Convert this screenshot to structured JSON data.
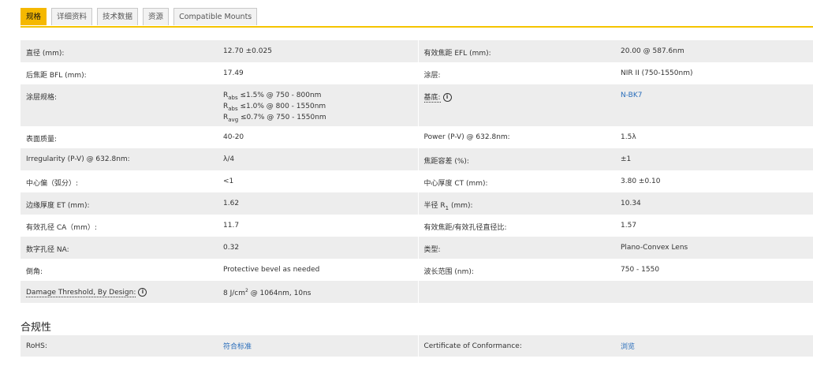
{
  "tabs": [
    {
      "label": "规格",
      "active": true
    },
    {
      "label": "详细资料",
      "active": false
    },
    {
      "label": "技术数据",
      "active": false
    },
    {
      "label": "资源",
      "active": false
    },
    {
      "label": "Compatible Mounts",
      "active": false
    }
  ],
  "specs": {
    "r1": {
      "l1": "直径 (mm):",
      "v1": "12.70 ±0.025",
      "l2": "有效焦距 EFL (mm):",
      "v2": "20.00 @ 587.6nm"
    },
    "r2": {
      "l1": "后焦距 BFL (mm):",
      "v1": "17.49",
      "l2": "涂层:",
      "v2": "NIR II (750-1550nm)"
    },
    "r3": {
      "l1": "涂层规格:",
      "coating": [
        {
          "sym": "R",
          "sub": "abs",
          "text": " ≤1.5% @ 750 - 800nm"
        },
        {
          "sym": "R",
          "sub": "abs",
          "text": " ≤1.0% @ 800 - 1550nm"
        },
        {
          "sym": "R",
          "sub": "avg",
          "text": " ≤0.7% @ 750 - 1550nm"
        }
      ],
      "l2": "基底:",
      "v2": "N-BK7"
    },
    "r4": {
      "l1": "表面质量:",
      "v1": "40-20",
      "l2": "Power (P-V) @ 632.8nm:",
      "v2": "1.5λ"
    },
    "r5": {
      "l1": "Irregularity (P-V) @ 632.8nm:",
      "v1": "λ/4",
      "l2": "焦距容差 (%):",
      "v2": "±1"
    },
    "r6": {
      "l1": "中心偏（弧分）:",
      "v1": "<1",
      "l2": "中心厚度 CT (mm):",
      "v2": "3.80 ±0.10"
    },
    "r7": {
      "l1": "边缘厚度 ET (mm):",
      "v1": "1.62",
      "l2_pre": "半径 R",
      "l2_sub": "1",
      "l2_post": " (mm):",
      "v2": "10.34"
    },
    "r8": {
      "l1": "有效孔径 CA（mm）:",
      "v1": "11.7",
      "l2": "有效焦距/有效孔径直径比:",
      "v2": "1.57"
    },
    "r9": {
      "l1": "数字孔径 NA:",
      "v1": "0.32",
      "l2": "类型:",
      "v2": "Plano-Convex Lens"
    },
    "r10": {
      "l1": "倒角:",
      "v1": "Protective bevel as needed",
      "l2": "波长范围 (nm):",
      "v2": "750 - 1550"
    },
    "r11": {
      "l1": "Damage Threshold, By Design:",
      "v1_pre": "8 J/cm",
      "v1_sup": "2",
      "v1_post": " @ 1064nm, 10ns"
    }
  },
  "info_icon": "i",
  "compliance": {
    "title": "合规性",
    "l1": "RoHS:",
    "v1": "符合标准",
    "l2": "Certificate of Conformance:",
    "v2": "浏览"
  },
  "colors": {
    "accent": "#f5b800",
    "link": "#2a6ebb",
    "row_grey": "#ededed"
  }
}
